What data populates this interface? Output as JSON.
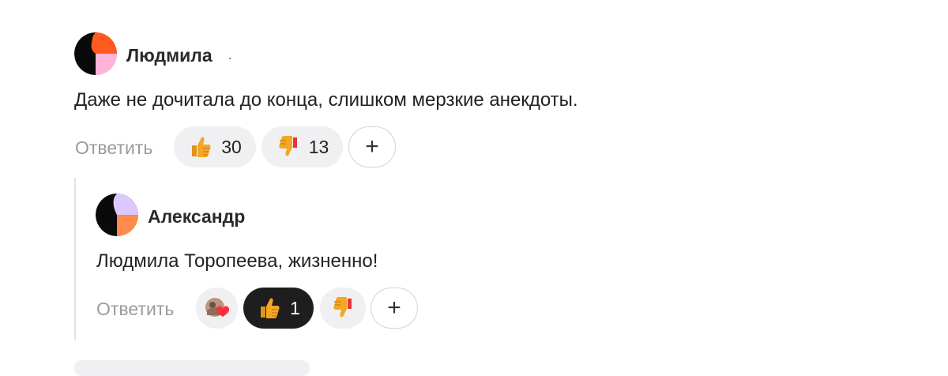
{
  "comment": {
    "author": "Людмила",
    "author_dot": ".",
    "text": "Даже не дочитала до конца, слишком мерзкие анекдоты.",
    "reply_label": "Ответить",
    "likes": "30",
    "dislikes": "13",
    "add_reaction": "+",
    "avatar_colors": [
      "#ff5a1f",
      "#ffb3d9",
      "#0a0a0a"
    ]
  },
  "reply": {
    "author": "Александр",
    "text": "Людмила Торопеева, жизненно!",
    "reply_label": "Ответить",
    "likes": "1",
    "add_reaction": "+",
    "like_active": true,
    "avatar_colors": [
      "#dcc8ff",
      "#ff8a4c",
      "#0a0a0a"
    ]
  },
  "icons": {
    "like": "thumbs-up-icon",
    "dislike": "thumbs-down-icon",
    "add": "plus-icon",
    "reactors": "reactor-avatar-heart-icon"
  },
  "colors": {
    "reply_link": "#9b9b9b",
    "pill_bg": "#f0f0f2",
    "pill_active_bg": "#1e1e1e",
    "thumb": "#f5a623"
  }
}
